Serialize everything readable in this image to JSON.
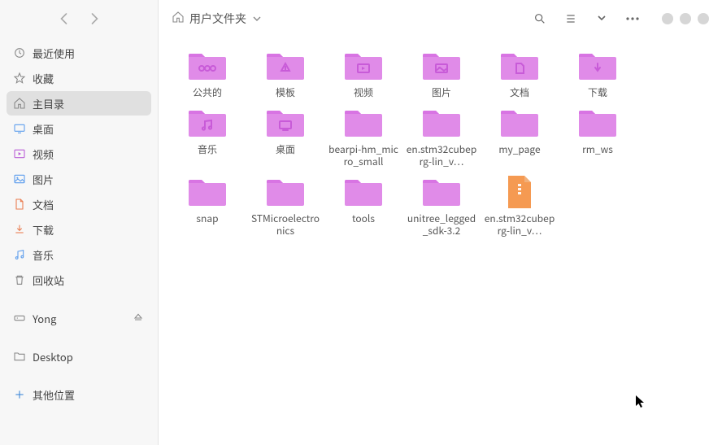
{
  "header": {
    "path_label": "用户文件夹"
  },
  "sidebar": {
    "items": [
      {
        "label": "最近使用",
        "icon": "recent-icon",
        "accent": "accent-recent"
      },
      {
        "label": "收藏",
        "icon": "star-icon",
        "accent": "accent-star"
      },
      {
        "label": "主目录",
        "icon": "home-icon",
        "accent": "accent-home",
        "selected": true
      },
      {
        "label": "桌面",
        "icon": "desktop-icon",
        "accent": "accent-desktop"
      },
      {
        "label": "视频",
        "icon": "video-icon",
        "accent": "accent-video"
      },
      {
        "label": "图片",
        "icon": "image-icon",
        "accent": "accent-image"
      },
      {
        "label": "文档",
        "icon": "document-icon",
        "accent": "accent-doc"
      },
      {
        "label": "下载",
        "icon": "download-icon",
        "accent": "accent-download"
      },
      {
        "label": "音乐",
        "icon": "music-icon",
        "accent": "accent-music"
      },
      {
        "label": "回收站",
        "icon": "trash-icon",
        "accent": "accent-trash"
      }
    ],
    "devices": [
      {
        "label": "Yong",
        "icon": "drive-icon",
        "accent": "accent-drive",
        "eject": true
      }
    ],
    "bookmarks": [
      {
        "label": "Desktop",
        "icon": "folder-icon",
        "accent": "accent-folder"
      }
    ],
    "other_location_label": "其他位置"
  },
  "folders": [
    {
      "name": "公共的",
      "glyph": "public"
    },
    {
      "name": "模板",
      "glyph": "templates"
    },
    {
      "name": "视频",
      "glyph": "videos"
    },
    {
      "name": "图片",
      "glyph": "pictures"
    },
    {
      "name": "文档",
      "glyph": "documents"
    },
    {
      "name": "下载",
      "glyph": "downloads"
    },
    {
      "name": "音乐",
      "glyph": "music"
    },
    {
      "name": "桌面",
      "glyph": "desktop"
    },
    {
      "name": "bearpi-hm_micro_small",
      "glyph": "plain"
    },
    {
      "name": "en.stm32cubeprg-lin_v…",
      "glyph": "plain"
    },
    {
      "name": "my_page",
      "glyph": "plain"
    },
    {
      "name": "rm_ws",
      "glyph": "plain"
    },
    {
      "name": "snap",
      "glyph": "plain"
    },
    {
      "name": "STMicroelectronics",
      "glyph": "plain"
    },
    {
      "name": "tools",
      "glyph": "plain"
    },
    {
      "name": "unitree_legged_sdk-3.2",
      "glyph": "plain"
    }
  ],
  "files": [
    {
      "name": "en.stm32cubeprg-lin_v…",
      "kind": "archive"
    }
  ],
  "colors": {
    "folder_fill": "#e08be8",
    "folder_tab": "#d874e3",
    "archive_fill": "#f59a52",
    "archive_top": "#f2b07a"
  }
}
